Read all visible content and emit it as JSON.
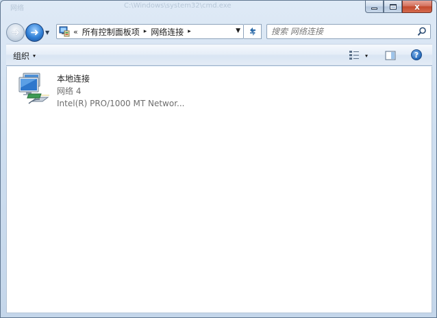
{
  "window": {
    "title_ghost": "C:\\Windows\\system32\\cmd.exe",
    "title_ghost_left": "网络",
    "minimize_label": "",
    "maximize_label": "",
    "close_label": "x"
  },
  "nav": {
    "back_icon": "back-arrow-icon",
    "forward_icon": "forward-arrow-icon",
    "recent_pages_icon": "chevron-down-icon"
  },
  "address": {
    "overflow": "«",
    "segments": [
      "所有控制面板项",
      "网络连接"
    ],
    "separator": "▸"
  },
  "search": {
    "placeholder": "搜索 网络连接"
  },
  "toolbar": {
    "organize_label": "组织",
    "dropdown_glyph": "▾",
    "help_label": "?"
  },
  "connections": [
    {
      "name": "本地连接",
      "network": "网络  4",
      "device": "Intel(R) PRO/1000 MT Networ..."
    }
  ],
  "colors": {
    "frame": "#c9dbed",
    "content_bg": "#ffffff",
    "secondary_text": "#6d6d6d",
    "accent_blue": "#2f7fd6",
    "close_red": "#c44a2e"
  }
}
